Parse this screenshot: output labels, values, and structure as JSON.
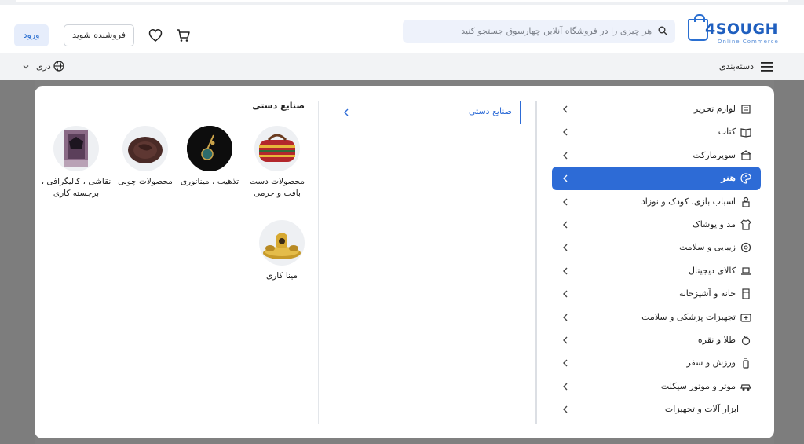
{
  "header": {
    "logo_text": "4SOUGH",
    "logo_subtitle": "Online Commerce",
    "search_placeholder": "هر چیزی را در فروشگاه آنلاین چهارسوق جستجو کنید",
    "seller_button": "فروشنده شوید",
    "login_button": "ورود"
  },
  "catbar": {
    "label": "دسته‌بندی",
    "language": "دری"
  },
  "categories": [
    {
      "label": "لوازم تحریر",
      "icon": "stationery-icon",
      "active": false
    },
    {
      "label": "کتاب",
      "icon": "book-icon",
      "active": false
    },
    {
      "label": "سوپرمارکت",
      "icon": "supermarket-icon",
      "active": false
    },
    {
      "label": "هنر",
      "icon": "palette-icon",
      "active": true
    },
    {
      "label": "اسباب بازی، کودک و نوزاد",
      "icon": "toy-icon",
      "active": false
    },
    {
      "label": "مد و پوشاک",
      "icon": "clothing-icon",
      "active": false
    },
    {
      "label": "زیبایی و سلامت",
      "icon": "beauty-icon",
      "active": false
    },
    {
      "label": "کالای دیجیتال",
      "icon": "laptop-icon",
      "active": false
    },
    {
      "label": "خانه و آشپزخانه",
      "icon": "kitchen-icon",
      "active": false
    },
    {
      "label": "تجهیزات پزشکی و سلامت",
      "icon": "medical-icon",
      "active": false
    },
    {
      "label": "طلا و نقره",
      "icon": "jewelry-icon",
      "active": false
    },
    {
      "label": "ورزش و سفر",
      "icon": "sport-icon",
      "active": false
    },
    {
      "label": "موتر و موتور سیکلت",
      "icon": "car-icon",
      "active": false
    },
    {
      "label": "ابزار آلات و تجهیزات",
      "icon": "",
      "active": false
    }
  ],
  "subcategory": {
    "label": "صنایع دستی"
  },
  "products_panel": {
    "title": "صنایع دستی",
    "items": [
      {
        "name": "محصولات دست بافت و چرمی",
        "icon": "handwoven-bag-image"
      },
      {
        "name": "تذهیب ، میناتوری",
        "icon": "miniature-art-image"
      },
      {
        "name": "محصولات چوبی",
        "icon": "wooden-plate-image"
      },
      {
        "name": "نقاشی ، کالیگرافی ، برجسته کاری",
        "icon": "painting-image"
      },
      {
        "name": "مینا کاری",
        "icon": "enamel-work-image"
      }
    ]
  },
  "colors": {
    "accent": "#2d6bd6",
    "backdrop": "#808080"
  }
}
